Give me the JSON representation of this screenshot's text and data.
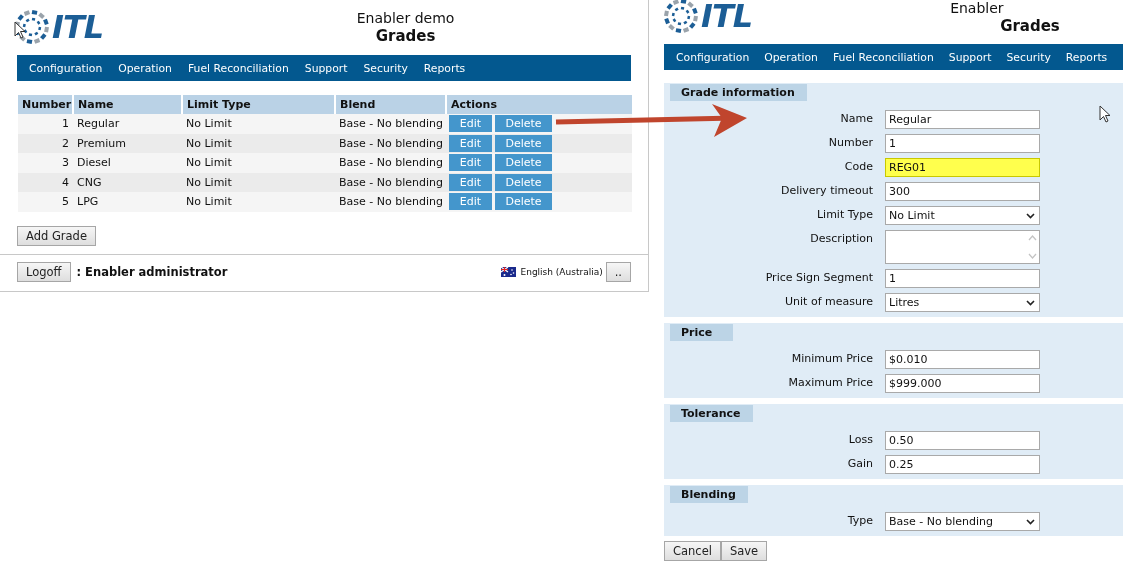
{
  "left": {
    "logo_text": "ITL",
    "app_title": "Enabler demo",
    "page_title": "Grades",
    "nav": [
      "Configuration",
      "Operation",
      "Fuel Reconciliation",
      "Support",
      "Security",
      "Reports"
    ],
    "table": {
      "columns": [
        "Number",
        "Name",
        "Limit Type",
        "Blend",
        "Actions"
      ],
      "rows": [
        {
          "number": "1",
          "name": "Regular",
          "limit_type": "No Limit",
          "blend": "Base - No blending",
          "actions": [
            "Edit",
            "Delete"
          ]
        },
        {
          "number": "2",
          "name": "Premium",
          "limit_type": "No Limit",
          "blend": "Base - No blending",
          "actions": [
            "Edit",
            "Delete"
          ]
        },
        {
          "number": "3",
          "name": "Diesel",
          "limit_type": "No Limit",
          "blend": "Base - No blending",
          "actions": [
            "Edit",
            "Delete"
          ]
        },
        {
          "number": "4",
          "name": "CNG",
          "limit_type": "No Limit",
          "blend": "Base - No blending",
          "actions": [
            "Edit",
            "Delete"
          ]
        },
        {
          "number": "5",
          "name": "LPG",
          "limit_type": "No Limit",
          "blend": "Base - No blending",
          "actions": [
            "Edit",
            "Delete"
          ]
        }
      ]
    },
    "add_button": "Add Grade",
    "footer": {
      "logoff": "Logoff",
      "user": ": Enabler administrator",
      "language": "English (Australia)",
      "more": ".."
    }
  },
  "right": {
    "logo_text": "ITL",
    "app_title": "Enabler",
    "page_title": "Grades",
    "nav": [
      "Configuration",
      "Operation",
      "Fuel Reconciliation",
      "Support",
      "Security",
      "Reports"
    ],
    "sections": [
      {
        "title": "Grade information",
        "fields": [
          {
            "label": "Name",
            "kind": "text",
            "value": "Regular",
            "highlighted": false
          },
          {
            "label": "Number",
            "kind": "text",
            "value": "1",
            "highlighted": false
          },
          {
            "label": "Code",
            "kind": "text",
            "value": "REG01",
            "highlighted": true
          },
          {
            "label": "Delivery timeout",
            "kind": "text",
            "value": "300",
            "highlighted": false
          },
          {
            "label": "Limit Type",
            "kind": "select",
            "value": "No Limit",
            "highlighted": false
          },
          {
            "label": "Description",
            "kind": "textarea",
            "highlighted": false
          },
          {
            "label": "Price Sign Segment",
            "kind": "text",
            "value": "1",
            "highlighted": false
          },
          {
            "label": "Unit of measure",
            "kind": "select",
            "value": "Litres",
            "highlighted": false
          }
        ]
      },
      {
        "title": "Price",
        "fields": [
          {
            "label": "Minimum Price",
            "kind": "text",
            "value": "$0.010",
            "highlighted": false
          },
          {
            "label": "Maximum Price",
            "kind": "text",
            "value": "$999.000",
            "highlighted": false
          }
        ]
      },
      {
        "title": "Tolerance",
        "fields": [
          {
            "label": "Loss",
            "kind": "text",
            "value": "0.50",
            "highlighted": false
          },
          {
            "label": "Gain",
            "kind": "text",
            "value": "0.25",
            "highlighted": false
          }
        ]
      },
      {
        "title": "Blending",
        "fields": [
          {
            "label": "Type",
            "kind": "select",
            "value": "Base - No blending",
            "highlighted": false
          }
        ]
      }
    ],
    "buttons": [
      "Cancel",
      "Save"
    ]
  }
}
